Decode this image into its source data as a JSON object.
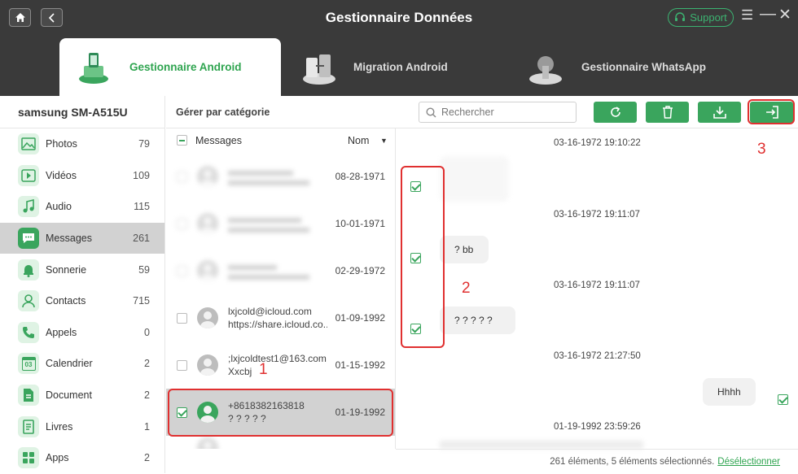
{
  "app": {
    "title": "Gestionnaire Données",
    "support_label": "Support"
  },
  "tabs": [
    {
      "label": "Gestionnaire Android",
      "active": true
    },
    {
      "label": "Migration Android",
      "active": false
    },
    {
      "label": "Gestionnaire WhatsApp",
      "active": false
    }
  ],
  "device": {
    "name": "samsung SM-A515U"
  },
  "sidebar": {
    "items": [
      {
        "label": "Photos",
        "count": "79",
        "icon": "photo-icon"
      },
      {
        "label": "Vidéos",
        "count": "109",
        "icon": "video-icon"
      },
      {
        "label": "Audio",
        "count": "115",
        "icon": "music-icon"
      },
      {
        "label": "Messages",
        "count": "261",
        "icon": "message-icon"
      },
      {
        "label": "Sonnerie",
        "count": "59",
        "icon": "bell-icon"
      },
      {
        "label": "Contacts",
        "count": "715",
        "icon": "contact-icon"
      },
      {
        "label": "Appels",
        "count": "0",
        "icon": "phone-icon"
      },
      {
        "label": "Calendrier",
        "count": "2",
        "icon": "calendar-icon"
      },
      {
        "label": "Document",
        "count": "2",
        "icon": "document-icon"
      },
      {
        "label": "Livres",
        "count": "1",
        "icon": "book-icon"
      },
      {
        "label": "Apps",
        "count": "2",
        "icon": "apps-icon"
      }
    ]
  },
  "calendar_icon_text": "03",
  "toolbar": {
    "category_label": "Gérer par catégorie",
    "search_placeholder": "Rechercher"
  },
  "list": {
    "header": {
      "label": "Messages",
      "sort_label": "Nom"
    },
    "rows": [
      {
        "line1": "",
        "line2": "",
        "date": "08-28-1971"
      },
      {
        "line1": "",
        "line2": "",
        "date": "10-01-1971"
      },
      {
        "line1": "",
        "line2": "",
        "date": "02-29-1972"
      },
      {
        "line1": "lxjcold@icloud.com",
        "line2": "https://share.icloud.co...",
        "date": "01-09-1992"
      },
      {
        "line1": ";lxjcoldtest1@163.com",
        "line2": "Xxcbj",
        "date": "01-15-1992"
      },
      {
        "line1": "+8618382163818",
        "line2": "? ? ? ? ?",
        "date": "01-19-1992"
      }
    ]
  },
  "conversation": {
    "timestamps": [
      "03-16-1972 19:10:22",
      "03-16-1972 19:11:07",
      "03-16-1972 19:11:07",
      "03-16-1972 21:27:50",
      "01-19-1992 23:59:26"
    ],
    "messages": [
      "",
      "? bb",
      "? ? ? ? ?",
      "Hhhh"
    ]
  },
  "annotations": {
    "one": "1",
    "two": "2",
    "three": "3"
  },
  "footer": {
    "status": "261 éléments, 5 éléments sélectionnés.",
    "link": "Désélectionner"
  }
}
